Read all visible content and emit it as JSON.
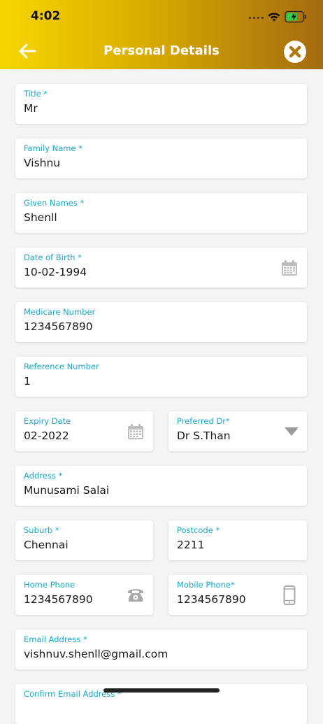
{
  "status": {
    "time": "4:02"
  },
  "header": {
    "title": "Personal Details",
    "accent": "#f7d600",
    "accent_end": "#a56a10"
  },
  "form": {
    "title": {
      "label": "Title *",
      "value": "Mr"
    },
    "family_name": {
      "label": "Family Name *",
      "value": "Vishnu"
    },
    "given_names": {
      "label": "Given Names *",
      "value": "Shenll"
    },
    "dob": {
      "label": "Date of Birth *",
      "value": "10-02-1994"
    },
    "medicare": {
      "label": "Medicare Number",
      "value": "1234567890"
    },
    "reference": {
      "label": "Reference Number",
      "value": "1"
    },
    "expiry": {
      "label": "Expiry Date",
      "value": "02-2022"
    },
    "preferred_dr": {
      "label": "Preferred Dr*",
      "value": "Dr S.Than"
    },
    "address": {
      "label": "Address *",
      "value": "Munusami Salai"
    },
    "suburb": {
      "label": "Suburb *",
      "value": "Chennai"
    },
    "postcode": {
      "label": "Postcode *",
      "value": "2211"
    },
    "home_phone": {
      "label": "Home Phone",
      "value": "1234567890"
    },
    "mobile_phone": {
      "label": "Mobile Phone*",
      "value": "1234567890"
    },
    "email": {
      "label": "Email Address *",
      "value": "vishnuv.shenll@gmail.com"
    },
    "confirm_email": {
      "label": "Confirm Email Address *",
      "value": ""
    }
  },
  "icons": {
    "back": "arrow-left-icon",
    "close": "close-icon",
    "calendar": "calendar-icon",
    "dropdown": "dropdown-arrow-icon",
    "phone": "telephone-icon",
    "mobile": "mobile-phone-icon"
  },
  "colors": {
    "label": "#17a7c8",
    "value": "#1a1a1a",
    "icon": "#b8b8b8"
  }
}
